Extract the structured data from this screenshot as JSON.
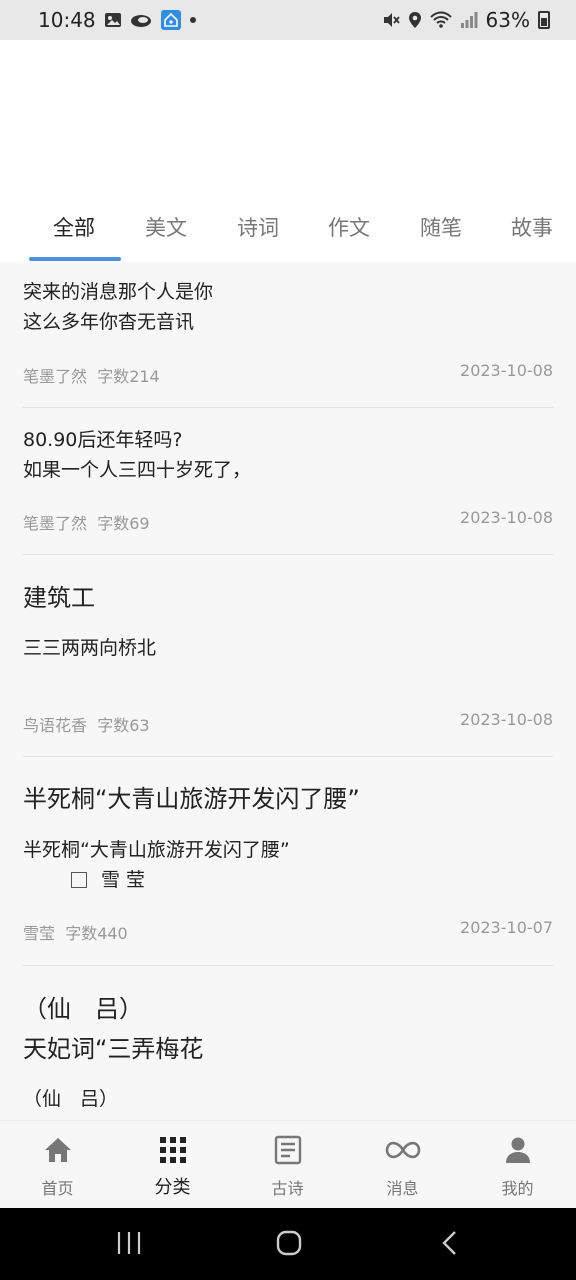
{
  "status_bar": {
    "time": "10:48",
    "battery": "63%",
    "icons": [
      "image-icon",
      "cloud-icon",
      "home-wifi-icon",
      "mute-icon",
      "location-icon",
      "wifi-icon",
      "signal-icon",
      "battery-icon"
    ]
  },
  "tabs": [
    {
      "label": "全部",
      "active": true
    },
    {
      "label": "美文",
      "active": false
    },
    {
      "label": "诗词",
      "active": false
    },
    {
      "label": "作文",
      "active": false
    },
    {
      "label": "随笔",
      "active": false
    },
    {
      "label": "故事",
      "active": false
    }
  ],
  "items": [
    {
      "title": "",
      "lines": [
        "突来的消息那个人是你",
        "这么多年你杳无音讯"
      ],
      "author": "笔墨了然",
      "count": "字数214",
      "date": "2023-10-08"
    },
    {
      "title": "",
      "lines": [
        "80.90后还年轻吗?",
        "如果一个人三四十岁死了，"
      ],
      "author": "笔墨了然",
      "count": "字数69",
      "date": "2023-10-08"
    },
    {
      "title": "建筑工",
      "lines": [
        "三三两两向桥北"
      ],
      "author": "鸟语花香",
      "count": "字数63",
      "date": "2023-10-08"
    },
    {
      "title": "半死桐“大青山旅游开发闪了腰”",
      "lines": [
        "半死桐“大青山旅游开发闪了腰”",
        "雪 莹"
      ],
      "author": "雪莹",
      "count": "字数440",
      "date": "2023-10-07"
    },
    {
      "title_lines": [
        "（仙　吕）",
        "天妃词“三弄梅花"
      ],
      "lines": [
        "（仙　吕）"
      ]
    }
  ],
  "bottom_nav": [
    {
      "label": "首页",
      "icon": "home-icon",
      "active": false
    },
    {
      "label": "分类",
      "icon": "grid-icon",
      "active": true
    },
    {
      "label": "古诗",
      "icon": "document-icon",
      "active": false
    },
    {
      "label": "消息",
      "icon": "infinity-icon",
      "active": false
    },
    {
      "label": "我的",
      "icon": "person-icon",
      "active": false
    }
  ],
  "colors": {
    "accent": "#4a8fe0",
    "list_bg": "#f7f7f7",
    "meta_text": "#999999"
  }
}
